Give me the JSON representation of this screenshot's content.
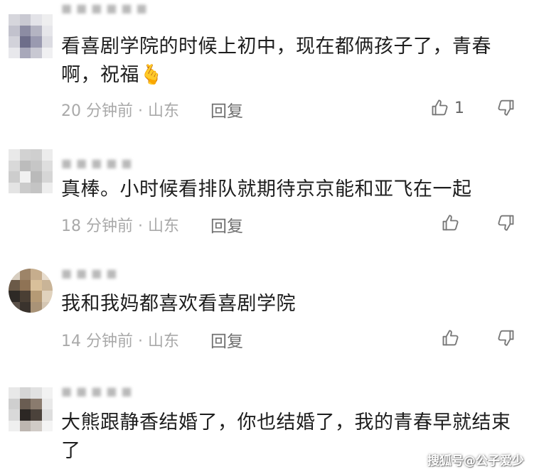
{
  "comments": [
    {
      "username": "■■■■■■",
      "text": "看喜剧学院的时候上初中，现在都俩孩子了，青春啊，祝福",
      "emoji": "🫰",
      "time": "20 分钟前 · 山东",
      "reply": "回复",
      "likes": "1"
    },
    {
      "username": "■■■■■",
      "text": "真棒。小时候看排队就期待京京能和亚飞在一起",
      "time": "18 分钟前 · 山东",
      "reply": "回复",
      "likes": ""
    },
    {
      "username": "■■■■",
      "text": "我和我妈都喜欢看喜剧学院",
      "time": "14 分钟前 · 山东",
      "reply": "回复",
      "likes": ""
    },
    {
      "username": "■■■■■",
      "text": "大熊跟静香结婚了，你也结婚了，我的青春早就结束了",
      "time": "",
      "reply": "",
      "likes": ""
    }
  ],
  "icons": {
    "like": "thumbs-up-icon",
    "dislike": "thumbs-down-icon"
  },
  "watermark": "搜狐号@公子爱少"
}
